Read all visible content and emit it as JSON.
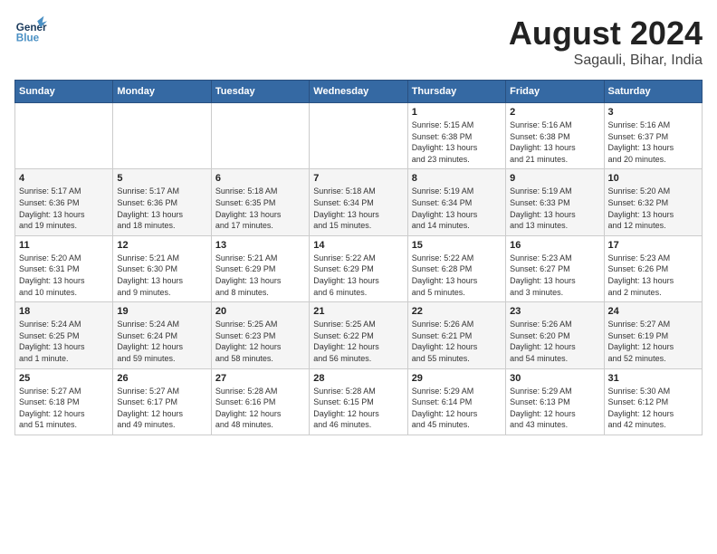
{
  "header": {
    "logo_general": "General",
    "logo_blue": "Blue",
    "title": "August 2024",
    "subtitle": "Sagauli, Bihar, India"
  },
  "weekdays": [
    "Sunday",
    "Monday",
    "Tuesday",
    "Wednesday",
    "Thursday",
    "Friday",
    "Saturday"
  ],
  "weeks": [
    [
      {
        "day": "",
        "info": ""
      },
      {
        "day": "",
        "info": ""
      },
      {
        "day": "",
        "info": ""
      },
      {
        "day": "",
        "info": ""
      },
      {
        "day": "1",
        "info": "Sunrise: 5:15 AM\nSunset: 6:38 PM\nDaylight: 13 hours\nand 23 minutes."
      },
      {
        "day": "2",
        "info": "Sunrise: 5:16 AM\nSunset: 6:38 PM\nDaylight: 13 hours\nand 21 minutes."
      },
      {
        "day": "3",
        "info": "Sunrise: 5:16 AM\nSunset: 6:37 PM\nDaylight: 13 hours\nand 20 minutes."
      }
    ],
    [
      {
        "day": "4",
        "info": "Sunrise: 5:17 AM\nSunset: 6:36 PM\nDaylight: 13 hours\nand 19 minutes."
      },
      {
        "day": "5",
        "info": "Sunrise: 5:17 AM\nSunset: 6:36 PM\nDaylight: 13 hours\nand 18 minutes."
      },
      {
        "day": "6",
        "info": "Sunrise: 5:18 AM\nSunset: 6:35 PM\nDaylight: 13 hours\nand 17 minutes."
      },
      {
        "day": "7",
        "info": "Sunrise: 5:18 AM\nSunset: 6:34 PM\nDaylight: 13 hours\nand 15 minutes."
      },
      {
        "day": "8",
        "info": "Sunrise: 5:19 AM\nSunset: 6:34 PM\nDaylight: 13 hours\nand 14 minutes."
      },
      {
        "day": "9",
        "info": "Sunrise: 5:19 AM\nSunset: 6:33 PM\nDaylight: 13 hours\nand 13 minutes."
      },
      {
        "day": "10",
        "info": "Sunrise: 5:20 AM\nSunset: 6:32 PM\nDaylight: 13 hours\nand 12 minutes."
      }
    ],
    [
      {
        "day": "11",
        "info": "Sunrise: 5:20 AM\nSunset: 6:31 PM\nDaylight: 13 hours\nand 10 minutes."
      },
      {
        "day": "12",
        "info": "Sunrise: 5:21 AM\nSunset: 6:30 PM\nDaylight: 13 hours\nand 9 minutes."
      },
      {
        "day": "13",
        "info": "Sunrise: 5:21 AM\nSunset: 6:29 PM\nDaylight: 13 hours\nand 8 minutes."
      },
      {
        "day": "14",
        "info": "Sunrise: 5:22 AM\nSunset: 6:29 PM\nDaylight: 13 hours\nand 6 minutes."
      },
      {
        "day": "15",
        "info": "Sunrise: 5:22 AM\nSunset: 6:28 PM\nDaylight: 13 hours\nand 5 minutes."
      },
      {
        "day": "16",
        "info": "Sunrise: 5:23 AM\nSunset: 6:27 PM\nDaylight: 13 hours\nand 3 minutes."
      },
      {
        "day": "17",
        "info": "Sunrise: 5:23 AM\nSunset: 6:26 PM\nDaylight: 13 hours\nand 2 minutes."
      }
    ],
    [
      {
        "day": "18",
        "info": "Sunrise: 5:24 AM\nSunset: 6:25 PM\nDaylight: 13 hours\nand 1 minute."
      },
      {
        "day": "19",
        "info": "Sunrise: 5:24 AM\nSunset: 6:24 PM\nDaylight: 12 hours\nand 59 minutes."
      },
      {
        "day": "20",
        "info": "Sunrise: 5:25 AM\nSunset: 6:23 PM\nDaylight: 12 hours\nand 58 minutes."
      },
      {
        "day": "21",
        "info": "Sunrise: 5:25 AM\nSunset: 6:22 PM\nDaylight: 12 hours\nand 56 minutes."
      },
      {
        "day": "22",
        "info": "Sunrise: 5:26 AM\nSunset: 6:21 PM\nDaylight: 12 hours\nand 55 minutes."
      },
      {
        "day": "23",
        "info": "Sunrise: 5:26 AM\nSunset: 6:20 PM\nDaylight: 12 hours\nand 54 minutes."
      },
      {
        "day": "24",
        "info": "Sunrise: 5:27 AM\nSunset: 6:19 PM\nDaylight: 12 hours\nand 52 minutes."
      }
    ],
    [
      {
        "day": "25",
        "info": "Sunrise: 5:27 AM\nSunset: 6:18 PM\nDaylight: 12 hours\nand 51 minutes."
      },
      {
        "day": "26",
        "info": "Sunrise: 5:27 AM\nSunset: 6:17 PM\nDaylight: 12 hours\nand 49 minutes."
      },
      {
        "day": "27",
        "info": "Sunrise: 5:28 AM\nSunset: 6:16 PM\nDaylight: 12 hours\nand 48 minutes."
      },
      {
        "day": "28",
        "info": "Sunrise: 5:28 AM\nSunset: 6:15 PM\nDaylight: 12 hours\nand 46 minutes."
      },
      {
        "day": "29",
        "info": "Sunrise: 5:29 AM\nSunset: 6:14 PM\nDaylight: 12 hours\nand 45 minutes."
      },
      {
        "day": "30",
        "info": "Sunrise: 5:29 AM\nSunset: 6:13 PM\nDaylight: 12 hours\nand 43 minutes."
      },
      {
        "day": "31",
        "info": "Sunrise: 5:30 AM\nSunset: 6:12 PM\nDaylight: 12 hours\nand 42 minutes."
      }
    ]
  ]
}
